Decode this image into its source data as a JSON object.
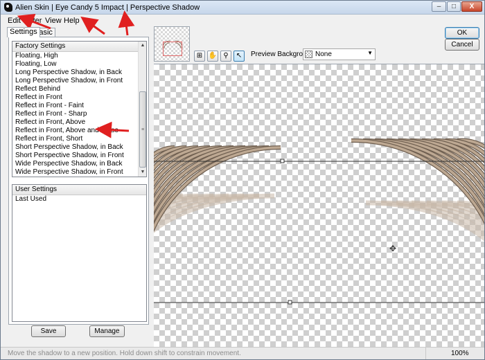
{
  "window": {
    "title": "Alien Skin | Eye Candy 5 Impact | Perspective Shadow",
    "controls": [
      "–",
      "□",
      "X"
    ]
  },
  "menu": [
    "Edit",
    "Filter",
    "View",
    "Help"
  ],
  "tabs": [
    "Settings",
    "Basic"
  ],
  "factory": {
    "header": "Factory Settings",
    "items": [
      "Floating, High",
      "Floating, Low",
      "Long Perspective Shadow, in Back",
      "Long Perspective Shadow, in Front",
      "Reflect Behind",
      "Reflect in Front",
      "Reflect in Front - Faint",
      "Reflect in Front - Sharp",
      "Reflect in Front, Above",
      "Reflect in Front, Above and Close",
      "Reflect in Front, Short",
      "Short Perspective Shadow, in Back",
      "Short Perspective Shadow, in Front",
      "Wide Perspective Shadow, in Back",
      "Wide Perspective Shadow, in Front"
    ]
  },
  "user": {
    "header": "User Settings",
    "items": [
      "Last Used"
    ]
  },
  "buttons": {
    "save": "Save",
    "manage": "Manage",
    "ok": "OK",
    "cancel": "Cancel"
  },
  "tools": [
    "zoom-fit-icon",
    "hand-icon",
    "magnifier-icon",
    "arrow-pointer-icon"
  ],
  "preview": {
    "label": "Preview Background:",
    "value": "None"
  },
  "status": {
    "hint": "Move the shadow to a new position. Hold down shift to constrain movement.",
    "zoom": "100%"
  },
  "colors": {
    "annotation_arrow": "#e02020",
    "ring_fill": "#bda892",
    "ring_edge": "#6f5f50",
    "reflection": "#c9b8a8"
  }
}
